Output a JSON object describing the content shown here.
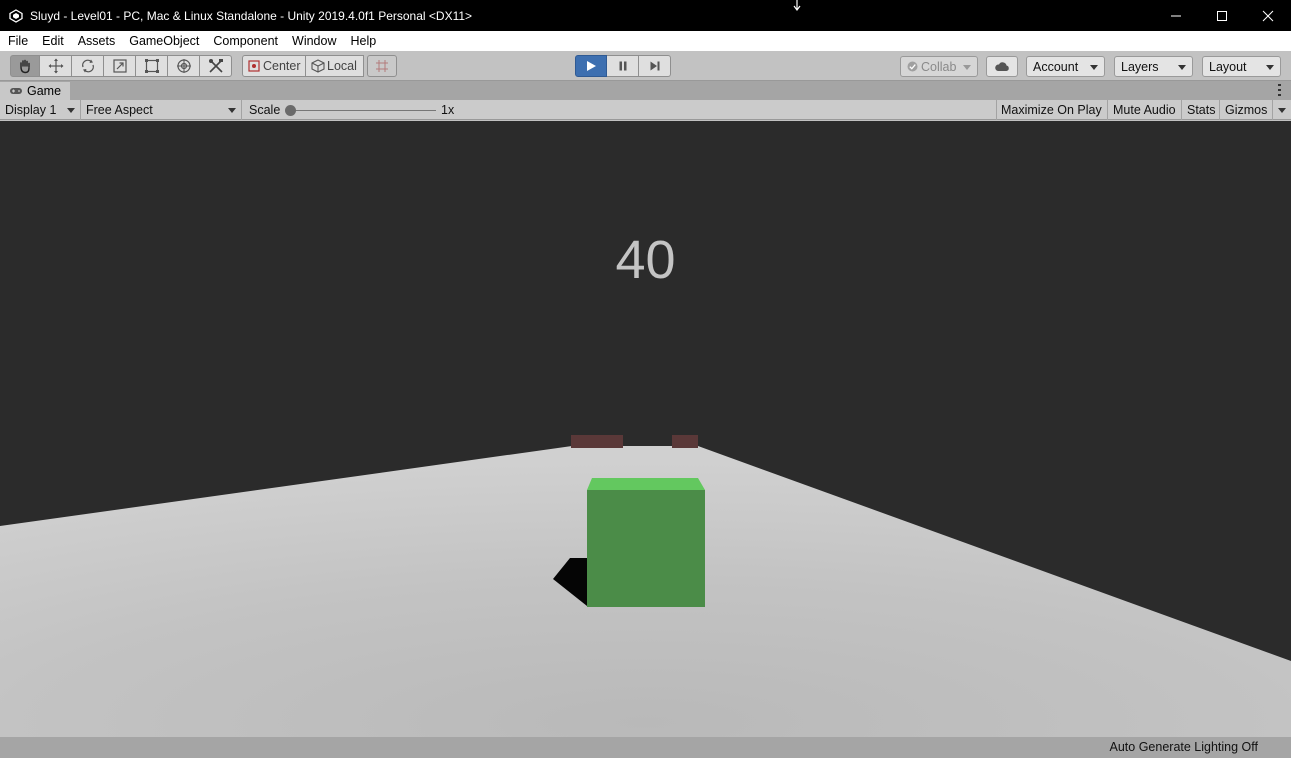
{
  "window": {
    "title": "Sluyd - Level01 - PC, Mac & Linux Standalone - Unity 2019.4.0f1 Personal <DX11>",
    "controls": [
      "minimize-icon",
      "maximize-icon",
      "close-icon"
    ]
  },
  "menu": {
    "items": [
      "File",
      "Edit",
      "Assets",
      "GameObject",
      "Component",
      "Window",
      "Help"
    ]
  },
  "toolbar": {
    "tools": [
      "hand-tool-icon",
      "move-tool-icon",
      "rotate-tool-icon",
      "scale-tool-icon",
      "rect-tool-icon",
      "transform-tool-icon",
      "custom-tool-icon"
    ],
    "pivot_mode": "Center",
    "pivot_rotation": "Local",
    "collab": "Collab",
    "account": "Account",
    "layers": "Layers",
    "layout": "Layout",
    "play_state": "playing"
  },
  "game_tab": {
    "label": "Game"
  },
  "game_bar": {
    "display": "Display 1",
    "aspect": "Free Aspect",
    "scale_label": "Scale",
    "scale_value": "1x",
    "maximize_on_play": "Maximize On Play",
    "mute_audio": "Mute Audio",
    "stats": "Stats",
    "gizmos": "Gizmos"
  },
  "game": {
    "score": "40",
    "colors": {
      "sky": "#2b2b2b",
      "ground": "#c4c4c4",
      "player": "#4b8c48",
      "player_top": "#63c85f",
      "obstacle": "#5a3838",
      "score_text": "#c4c4c4"
    }
  },
  "status": {
    "text": "Auto Generate Lighting Off"
  }
}
